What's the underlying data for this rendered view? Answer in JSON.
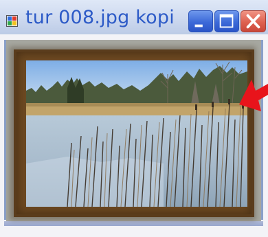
{
  "window": {
    "title": "tur 008.jpg kopi",
    "icons": {
      "app": "image-file-icon",
      "minimize": "minimize-icon",
      "maximize": "maximize-icon",
      "close": "close-icon",
      "annotation": "red-arrow-icon"
    }
  },
  "colors": {
    "title_text": "#2d5bc7",
    "caption_button_blue": "#3c69d8",
    "close_button_red": "#de6150",
    "frame_brown": "#6e4a22",
    "annotation_arrow": "#e8141b"
  }
}
